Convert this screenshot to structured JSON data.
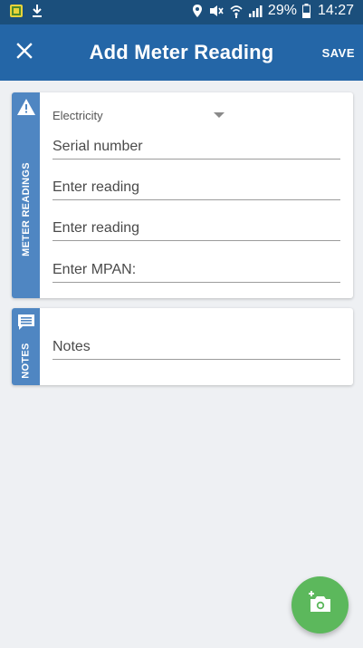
{
  "status_bar": {
    "battery_percent": "29%",
    "time": "14:27",
    "icons": [
      "gallery-icon",
      "download-icon",
      "location-icon",
      "mute-icon",
      "wifi-icon",
      "signal-icon",
      "battery-icon"
    ]
  },
  "app_bar": {
    "title": "Add Meter Reading",
    "save_label": "SAVE",
    "close_icon": "close-icon"
  },
  "meter_readings": {
    "section_label": "METER READINGS",
    "section_icon": "warning-icon",
    "meter_type": "Electricity",
    "fields": {
      "serial_placeholder": "Serial number",
      "reading1_placeholder": "Enter reading",
      "reading2_placeholder": "Enter reading",
      "mpan_placeholder": "Enter MPAN:"
    }
  },
  "notes": {
    "section_label": "NOTES",
    "section_icon": "comment-icon",
    "placeholder": "Notes"
  },
  "fab": {
    "icon": "add-photo-icon"
  },
  "colors": {
    "status_bar": "#1b4f7c",
    "app_bar": "#2466a7",
    "side_tab": "#4f86c2",
    "fab": "#5cb85c",
    "background": "#eef0f3"
  }
}
